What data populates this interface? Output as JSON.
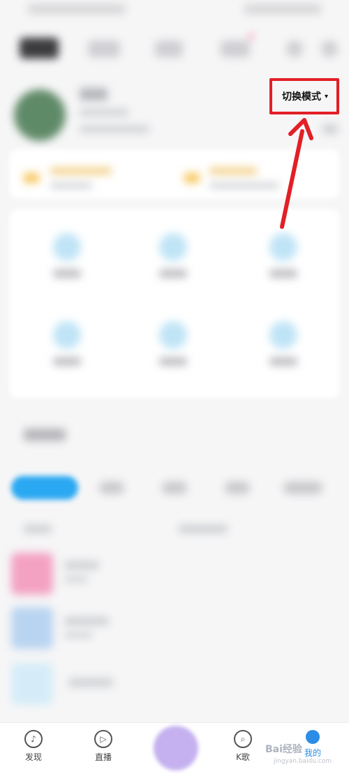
{
  "mode_switch": {
    "label": "切换模式",
    "caret": "▾"
  },
  "bottom_nav": {
    "items": [
      {
        "label": "发现",
        "icon": "music-note-icon"
      },
      {
        "label": "直播",
        "icon": "play-icon"
      },
      {
        "label": "K歌",
        "icon": "microphone-icon"
      },
      {
        "label": "我的",
        "icon": "profile-icon"
      }
    ]
  },
  "watermark": {
    "text": "Bai",
    "text2": "经验",
    "sub": "jingyan.baidu.com"
  },
  "colors": {
    "annotation_red": "#e21f26",
    "active_nav": "#2b8de6"
  }
}
